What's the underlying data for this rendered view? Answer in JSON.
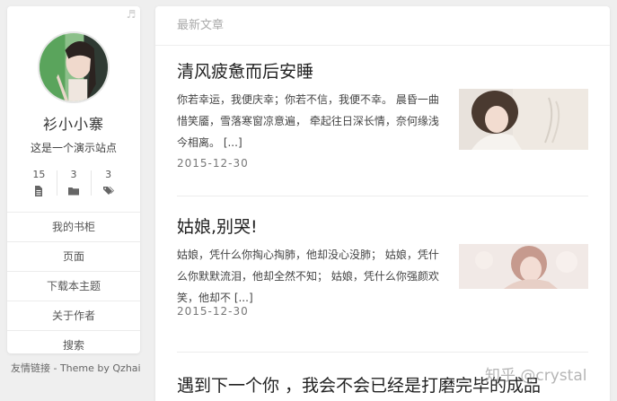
{
  "sidebar": {
    "site_name": "衫小小寨",
    "site_desc": "这是一个演示站点",
    "stats": [
      {
        "value": "15",
        "icon": "file-icon"
      },
      {
        "value": "3",
        "icon": "folder-icon"
      },
      {
        "value": "3",
        "icon": "tags-icon"
      }
    ],
    "menu": [
      {
        "label": "我的书柜"
      },
      {
        "label": "页面"
      },
      {
        "label": "下载本主题"
      },
      {
        "label": "关于作者"
      },
      {
        "label": "搜索"
      }
    ],
    "footer": "友情链接 - Theme by Qzhai"
  },
  "main": {
    "header": "最新文章",
    "posts": [
      {
        "title": "清风疲惫而后安睡",
        "excerpt": "你若幸运，我便庆幸；你若不信，我便不幸。 晨昏一曲惜笑靥，雪落寒窗凉意遍， 牵起往日深长情，奈何缘浅今相离。 [...]",
        "date": "2015-12-30"
      },
      {
        "title": "姑娘,别哭!",
        "excerpt": "姑娘，凭什么你掏心掏肺，他却没心没肺； 姑娘，凭什么你默默流泪，他却全然不知； 姑娘，凭什么你强颜欢笑，他却不 [...]",
        "date": "2015-12-30"
      },
      {
        "title": "遇到下一个你 ，我会不会已经是打磨完毕的成品"
      }
    ]
  },
  "watermark": "知乎 @crystal"
}
